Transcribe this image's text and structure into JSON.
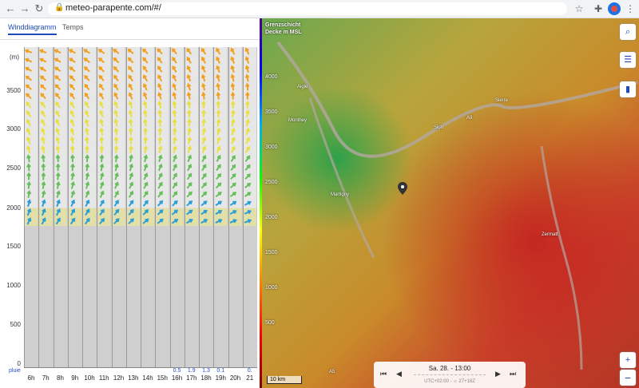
{
  "browser": {
    "url": "meteo-parapente.com/#/"
  },
  "tabs": [
    "Winddiagramm",
    "Temps"
  ],
  "diagram": {
    "unit_label": "(m)",
    "y_labels": [
      "3500",
      "3000",
      "2500",
      "2000",
      "1500",
      "1000",
      "500",
      "0"
    ],
    "rain_label": "pluie",
    "hours": [
      "6h",
      "7h",
      "8h",
      "9h",
      "10h",
      "11h",
      "12h",
      "13h",
      "14h",
      "15h",
      "16h",
      "17h",
      "18h",
      "19h",
      "20h",
      "21"
    ],
    "rain_values": [
      "",
      "",
      "",
      "",
      "",
      "",
      "",
      "",
      "",
      "",
      "0.5",
      "1.9",
      "1.3",
      "0.1",
      "",
      "0."
    ]
  },
  "map": {
    "legend_title": "Grenzschicht Decke m MSL",
    "alt_labels": [
      "4000",
      "3500",
      "3000",
      "2500",
      "2000",
      "1500",
      "1000",
      "500"
    ],
    "places": [
      "Aigle",
      "Monthey",
      "Sion",
      "Sierre",
      "Martigny",
      "Zermatt",
      "A9",
      "A5"
    ],
    "time_label": "Sa. 28. - 13:00",
    "utc_label": "UTC+02:00 - ☼ 27+18Z",
    "scale_label": "10 km",
    "colors": {
      "low": "#2e9e3a",
      "mid": "#d8c43a",
      "high": "#d9301e"
    }
  }
}
